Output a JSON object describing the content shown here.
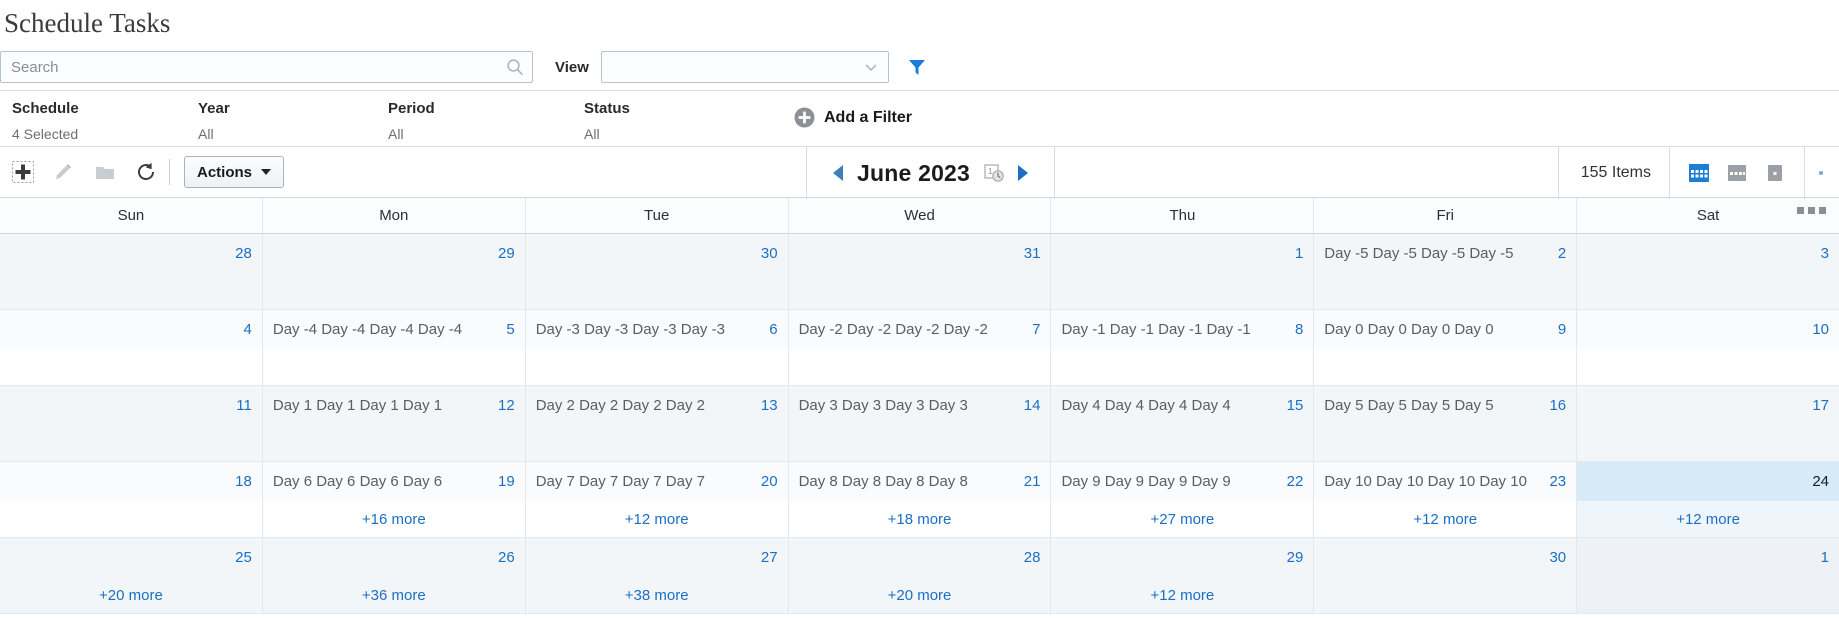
{
  "page_title": "Schedule Tasks",
  "search": {
    "placeholder": "Search",
    "value": "",
    "icon": "search-icon"
  },
  "view": {
    "label": "View",
    "value": "",
    "options": []
  },
  "filter_icon": "funnel-icon",
  "filters": [
    {
      "label": "Schedule",
      "value": "4 Selected"
    },
    {
      "label": "Year",
      "value": "All"
    },
    {
      "label": "Period",
      "value": "All"
    },
    {
      "label": "Status",
      "value": "All"
    }
  ],
  "add_filter": {
    "label": "Add a Filter",
    "icon": "plus-circle-icon"
  },
  "overflow_menu": "ellipsis-icon",
  "toolbar": {
    "icons": [
      "add-icon",
      "edit-icon",
      "folder-icon",
      "refresh-icon"
    ],
    "actions_label": "Actions",
    "date_label": "June 2023",
    "prev_icon": "prev-arrow-icon",
    "next_icon": "next-arrow-icon",
    "date_picker_icon": "date-picker-icon",
    "items_count": "155 Items",
    "view_icons": [
      "month-view-icon",
      "week-view-icon",
      "day-view-icon"
    ],
    "calendar_icon": "calendar-icon"
  },
  "calendar": {
    "day_headers": [
      "Sun",
      "Mon",
      "Tue",
      "Wed",
      "Thu",
      "Fri",
      "Sat"
    ],
    "weeks": [
      {
        "shade": "a",
        "days": [
          {
            "num": "28",
            "event": "",
            "more": ""
          },
          {
            "num": "29",
            "event": "",
            "more": ""
          },
          {
            "num": "30",
            "event": "",
            "more": ""
          },
          {
            "num": "31",
            "event": "",
            "more": ""
          },
          {
            "num": "1",
            "event": "",
            "more": ""
          },
          {
            "num": "2",
            "event": "Day -5 Day -5 Day -5 Day -5",
            "more": ""
          },
          {
            "num": "3",
            "event": "",
            "more": ""
          }
        ]
      },
      {
        "shade": "b",
        "days": [
          {
            "num": "4",
            "event": "",
            "more": ""
          },
          {
            "num": "5",
            "event": "Day -4 Day -4 Day -4 Day -4",
            "more": ""
          },
          {
            "num": "6",
            "event": "Day -3 Day -3 Day -3 Day -3",
            "more": ""
          },
          {
            "num": "7",
            "event": "Day -2 Day -2 Day -2 Day -2",
            "more": ""
          },
          {
            "num": "8",
            "event": "Day -1 Day -1 Day -1 Day -1",
            "more": ""
          },
          {
            "num": "9",
            "event": "Day 0 Day 0 Day 0 Day 0",
            "more": ""
          },
          {
            "num": "10",
            "event": "",
            "more": ""
          }
        ]
      },
      {
        "shade": "a",
        "days": [
          {
            "num": "11",
            "event": "",
            "more": ""
          },
          {
            "num": "12",
            "event": "Day 1 Day 1 Day 1 Day 1",
            "more": ""
          },
          {
            "num": "13",
            "event": "Day 2 Day 2 Day 2 Day 2",
            "more": ""
          },
          {
            "num": "14",
            "event": "Day 3 Day 3 Day 3 Day 3",
            "more": ""
          },
          {
            "num": "15",
            "event": "Day 4 Day 4 Day 4 Day 4",
            "more": ""
          },
          {
            "num": "16",
            "event": "Day 5 Day 5 Day 5 Day 5",
            "more": ""
          },
          {
            "num": "17",
            "event": "",
            "more": ""
          }
        ]
      },
      {
        "shade": "b",
        "days": [
          {
            "num": "18",
            "event": "",
            "more": ""
          },
          {
            "num": "19",
            "event": "Day 6 Day 6 Day 6 Day 6",
            "more": "+16 more"
          },
          {
            "num": "20",
            "event": "Day 7 Day 7 Day 7 Day 7",
            "more": "+12 more"
          },
          {
            "num": "21",
            "event": "Day 8 Day 8 Day 8 Day 8",
            "more": "+18 more"
          },
          {
            "num": "22",
            "event": "Day 9 Day 9 Day 9 Day 9",
            "more": "+27 more"
          },
          {
            "num": "23",
            "event": "Day 10 Day 10 Day 10 Day 10",
            "more": "+12 more"
          },
          {
            "num": "24",
            "event": "",
            "more": "+12 more",
            "today": true
          }
        ]
      },
      {
        "shade": "a",
        "days": [
          {
            "num": "25",
            "event": "",
            "more": "+20 more"
          },
          {
            "num": "26",
            "event": "",
            "more": "+36 more"
          },
          {
            "num": "27",
            "event": "",
            "more": "+38 more"
          },
          {
            "num": "28",
            "event": "",
            "more": "+20 more"
          },
          {
            "num": "29",
            "event": "",
            "more": "+12 more"
          },
          {
            "num": "30",
            "event": "",
            "more": ""
          },
          {
            "num": "1",
            "event": "",
            "more": "",
            "weekend_tint": true
          }
        ]
      }
    ]
  },
  "colors": {
    "accent": "#1a6fc4",
    "link": "#1a6fc4",
    "today_bg": "#d6eaf8",
    "header_text": "#2f2f2f",
    "event_text": "#5d5d5d"
  }
}
